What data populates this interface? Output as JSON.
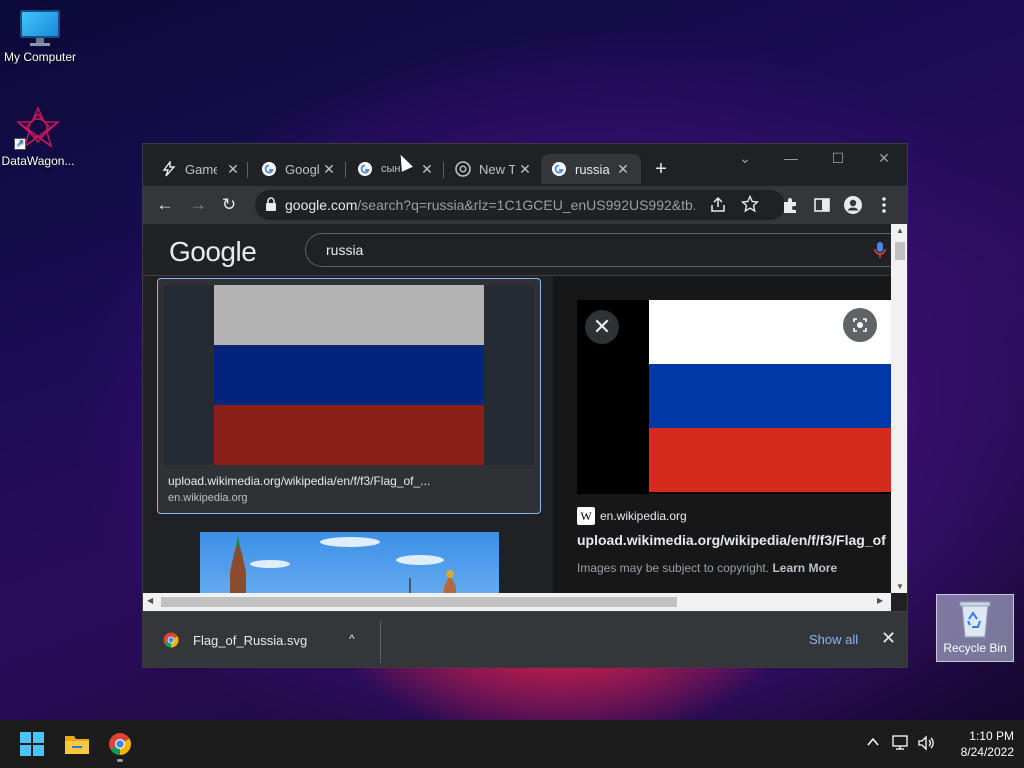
{
  "desktop": {
    "icons": [
      {
        "label": "My Computer",
        "icon": "monitor-icon"
      },
      {
        "label": "DataWagon...",
        "icon": "datawagon-icon"
      }
    ],
    "recycle_bin": {
      "label": "Recycle Bin",
      "icon": "recycle-bin-icon"
    }
  },
  "browser": {
    "tabs": [
      {
        "title": "Game",
        "icon": "lightning-icon",
        "active": false
      },
      {
        "title": "Googl",
        "icon": "google-icon",
        "active": false
      },
      {
        "title": "сын",
        "icon": "google-icon",
        "active": false
      },
      {
        "title": "New T",
        "icon": "chrome-icon",
        "active": false
      },
      {
        "title": "russia",
        "icon": "google-icon",
        "active": true
      }
    ],
    "new_tab_label": "+",
    "window_controls": {
      "tab_search": "⌄",
      "minimize": "—",
      "maximize": "☐",
      "close": "✕"
    },
    "toolbar": {
      "back": "←",
      "forward": "→",
      "reload": "↻",
      "url_host": "google.com",
      "url_path": "/search?q=russia&rlz=1C1GCEU_enUS992US992&tb..."
    },
    "page": {
      "logo": "Google",
      "search_query": "russia",
      "result": {
        "title": "upload.wikimedia.org/wikipedia/en/f/f3/Flag_of_...",
        "domain": "en.wikipedia.org"
      },
      "side_panel": {
        "close": "✕",
        "source_letter": "W",
        "source": "en.wikipedia.org",
        "title": "upload.wikimedia.org/wikipedia/en/f/f3/Flag_of",
        "copyright": "Images may be subject to copyright.",
        "learn_more": "Learn More"
      }
    },
    "download_bar": {
      "filename": "Flag_of_Russia.svg",
      "caret": "^",
      "show_all": "Show all",
      "close": "✕"
    }
  },
  "flag_colors": {
    "white": "#ffffff",
    "blue": "#0039a6",
    "red": "#d52b1e"
  },
  "taskbar": {
    "pinned": [
      "start-icon",
      "file-explorer-icon",
      "chrome-icon"
    ],
    "time": "1:10 PM",
    "date": "8/24/2022"
  }
}
